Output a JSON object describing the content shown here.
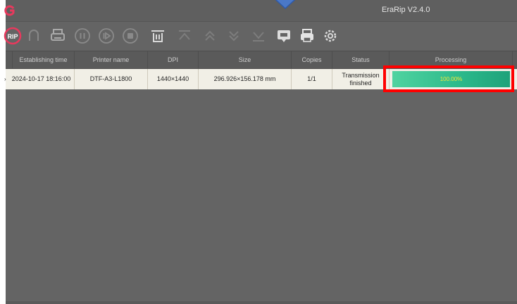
{
  "window": {
    "title": "EraRip V2.4.0"
  },
  "toolbar": {
    "items": [
      {
        "name": "rip-button",
        "label": "RIP"
      },
      {
        "name": "magnet-icon"
      },
      {
        "name": "print-icon"
      },
      {
        "name": "pause-icon"
      },
      {
        "name": "resume-icon"
      },
      {
        "name": "stop-icon"
      },
      {
        "name": "delete-icon"
      },
      {
        "name": "move-top-icon"
      },
      {
        "name": "move-up-icon"
      },
      {
        "name": "move-down-icon"
      },
      {
        "name": "move-bottom-icon"
      },
      {
        "name": "preview-icon"
      },
      {
        "name": "printer-settings-icon"
      },
      {
        "name": "settings-icon"
      }
    ]
  },
  "table": {
    "columns": [
      "Establishing time",
      "Printer name",
      "DPI",
      "Size",
      "Copies",
      "Status",
      "Processing"
    ],
    "rows": [
      {
        "time": "2024-10-17 18:16:00",
        "printer": "DTF-A3-L1800",
        "dpi": "1440×1440",
        "size": "296.926×156.178 mm",
        "copies": "1/1",
        "status_line1": "Transmission",
        "status_line2": "finished",
        "processing_text": "100.00%",
        "processing_fraction": 1.0
      }
    ]
  },
  "colors": {
    "background": "#646464",
    "row_background": "#f1efe6",
    "progress_fill": "#2bb88a",
    "progress_text": "#f3e63b",
    "highlight": "#ff0000",
    "pointer": "#4a78c8"
  }
}
